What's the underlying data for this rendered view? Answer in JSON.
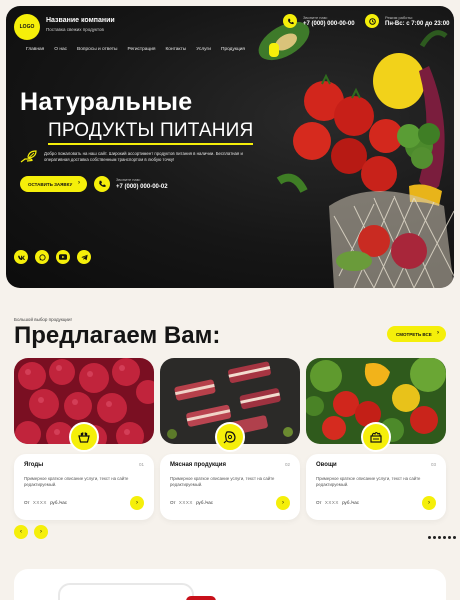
{
  "header": {
    "logo_text": "LOGO",
    "brand_name": "Название компании",
    "brand_tagline": "Поставка свежих продуктов",
    "phone_label": "Звоните нам:",
    "phone_value": "+7 (000) 000-00-00",
    "hours_label": "Режим работы:",
    "hours_value": "Пн-Вс: с 7:00 до 23:00"
  },
  "nav": {
    "items": [
      "Главная",
      "О нас",
      "Вопросы и ответы",
      "Регистрация",
      "Контакты",
      "Услуги",
      "Продукция"
    ]
  },
  "hero": {
    "title_line1": "Натуральные",
    "title_line2": "ПРОДУКТЫ ПИТАНИЯ",
    "description": "Добро пожаловать на наш сайт. Широкий ассортимент продуктов питания в наличии. Бесплатная и оперативная доставка собственным транспортом в любую точку!",
    "cta_label": "ОСТАВИТЬ ЗАЯВКУ",
    "phone_label": "Звоните нам:",
    "phone_value": "+7 (000) 000-00-02"
  },
  "services": {
    "eyebrow": "Большой выбор продукции!",
    "title": "Предлагаем Вам:",
    "see_all_label": "СМОТРЕТЬ ВСЕ",
    "cards": [
      {
        "title": "Ягоды",
        "number": "01",
        "description": "Примерное краткое описание услуги, текст на сайте редактируемый.",
        "price_prefix": "От",
        "price_value": "XXXX",
        "price_unit": "руб./час"
      },
      {
        "title": "Мясная продукция",
        "number": "02",
        "description": "Примерное краткое описание услуги, текст на сайте редактируемый.",
        "price_prefix": "От",
        "price_value": "XXXX",
        "price_unit": "руб./час"
      },
      {
        "title": "Овощи",
        "number": "03",
        "description": "Примерное краткое описание услуги, текст на сайте редактируемый.",
        "price_prefix": "От",
        "price_value": "XXXX",
        "price_unit": "руб./час"
      }
    ]
  },
  "icons": {
    "phone": "phone-icon",
    "clock": "clock-icon",
    "leaf": "leaf-hand-icon",
    "arrow": "chevron-right-icon",
    "socials": [
      "vk-icon",
      "whatsapp-icon",
      "youtube-icon",
      "telegram-icon"
    ]
  },
  "colors": {
    "accent": "#f5ef0a",
    "hero_bg": "#141414",
    "page_bg": "#f6f2ec"
  }
}
